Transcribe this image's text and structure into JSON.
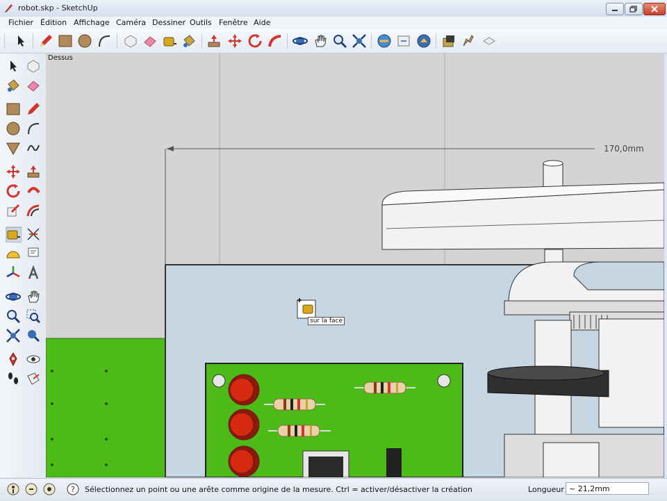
{
  "window": {
    "title": "robot.skp - SketchUp"
  },
  "menu": [
    "Fichier",
    "Édition",
    "Affichage",
    "Caméra",
    "Dessiner",
    "Outils",
    "Fenêtre",
    "Aide"
  ],
  "viewport": {
    "view_label": "Dessus",
    "dimension_label": "170,0mm",
    "cursor_tooltip": "sur la face"
  },
  "status": {
    "message": "Sélectionnez un point ou une arête comme origine de la mesure.  Ctrl = activer/désactiver la création",
    "length_label": "Longueur",
    "length_value": "~ 21,2mm"
  },
  "toolbar_icons": [
    "select-icon",
    "pencil-icon",
    "rectangle-icon",
    "circle-icon",
    "arc-icon",
    "make-component-icon",
    "eraser-icon",
    "tape-measure-icon",
    "paint-bucket-icon",
    "push-pull-icon",
    "move-icon",
    "rotate-icon",
    "follow-me-icon",
    "orbit-icon",
    "pan-icon",
    "zoom-icon",
    "zoom-extents-icon",
    "get-models-icon",
    "share-model-icon",
    "extension-icon",
    "component-icon",
    "style-icon",
    "layer-icon"
  ],
  "left_icons": [
    "select-icon",
    "make-component-icon",
    "paint-bucket-icon",
    "eraser-icon",
    "rectangle-icon",
    "line-icon",
    "circle-icon",
    "arc-icon",
    "polygon-icon",
    "freehand-icon",
    "move-icon",
    "push-pull-icon",
    "rotate-icon",
    "follow-me-icon",
    "scale-icon",
    "offset-icon",
    "tape-measure-icon",
    "dimension-icon",
    "protractor-icon",
    "text-icon",
    "axes-icon",
    "3d-text-icon",
    "orbit-icon",
    "pan-icon",
    "zoom-icon",
    "zoom-window-icon",
    "zoom-extents-icon",
    "previous-view-icon",
    "position-camera-icon",
    "look-around-icon",
    "walk-icon",
    "section-plane-icon"
  ],
  "colors": {
    "green": "#4cbb17",
    "board_light": "#c6d6e2",
    "bg": "#d4d4d4",
    "resistor": "#e8d3a8",
    "led": "#d62a10"
  }
}
